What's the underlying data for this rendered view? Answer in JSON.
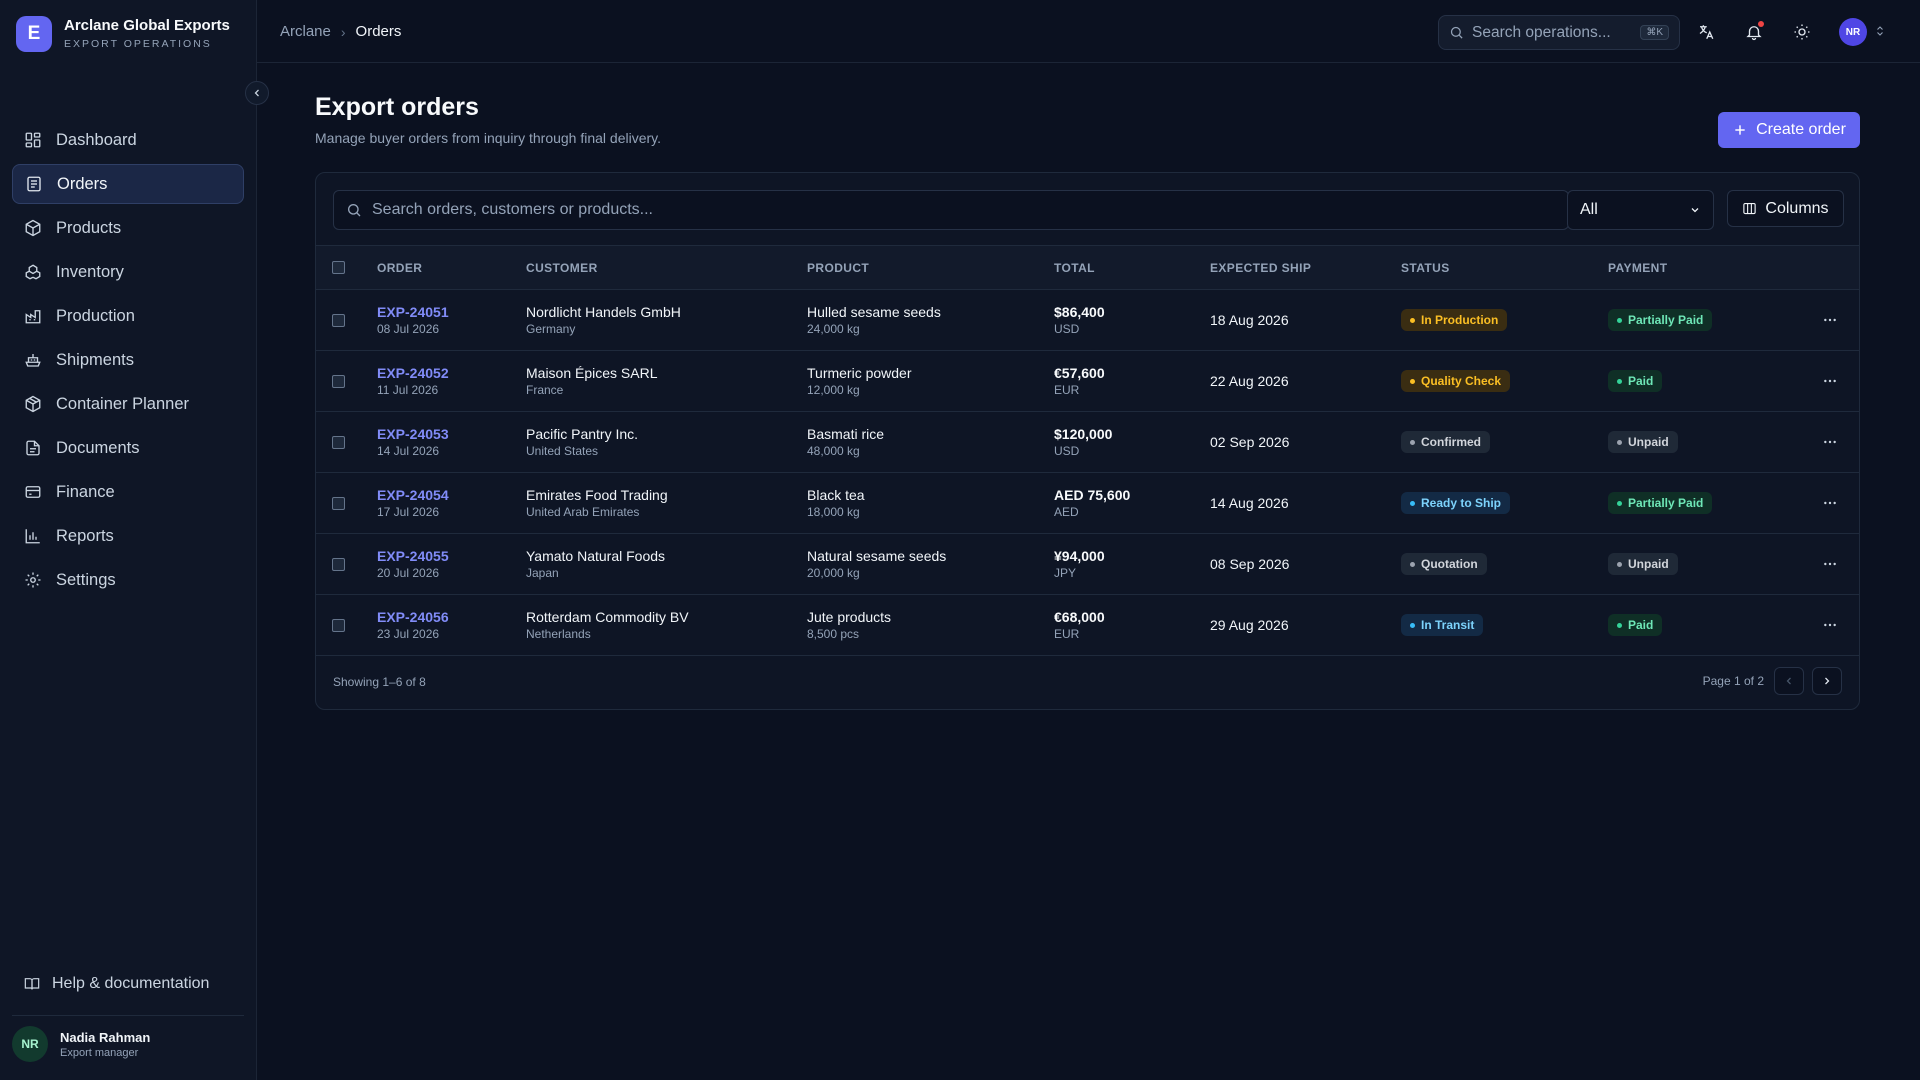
{
  "brand": {
    "logo_letter": "E",
    "name": "Arclane Global Exports",
    "subtitle": "EXPORT OPERATIONS"
  },
  "sidebar": {
    "items": [
      {
        "label": "Dashboard",
        "icon": "dashboard-icon"
      },
      {
        "label": "Orders",
        "icon": "orders-icon",
        "active": true
      },
      {
        "label": "Products",
        "icon": "products-icon"
      },
      {
        "label": "Inventory",
        "icon": "inventory-icon"
      },
      {
        "label": "Production",
        "icon": "production-icon"
      },
      {
        "label": "Shipments",
        "icon": "shipments-icon"
      },
      {
        "label": "Container Planner",
        "icon": "container-icon"
      },
      {
        "label": "Documents",
        "icon": "documents-icon"
      },
      {
        "label": "Finance",
        "icon": "finance-icon"
      },
      {
        "label": "Reports",
        "icon": "reports-icon"
      },
      {
        "label": "Settings",
        "icon": "settings-icon"
      }
    ],
    "help_label": "Help & documentation",
    "user": {
      "initials": "NR",
      "name": "Nadia Rahman",
      "role": "Export manager"
    }
  },
  "topbar": {
    "breadcrumb": [
      "Arclane",
      "Orders"
    ],
    "search_placeholder": "Search operations...",
    "search_shortcut": "⌘K",
    "avatar_initials": "NR"
  },
  "page": {
    "title": "Export orders",
    "subtitle": "Manage buyer orders from inquiry through final delivery.",
    "create_label": "Create order"
  },
  "table": {
    "search_placeholder": "Search orders, customers or products...",
    "filter_value": "All",
    "columns_label": "Columns",
    "headers": {
      "order": "ORDER",
      "customer": "CUSTOMER",
      "product": "PRODUCT",
      "total": "TOTAL",
      "ship": "EXPECTED SHIP",
      "status": "STATUS",
      "payment": "PAYMENT"
    },
    "rows": [
      {
        "id": "EXP-24051",
        "date": "08 Jul 2026",
        "customer": "Nordlicht Handels GmbH",
        "country": "Germany",
        "product": "Hulled sesame seeds",
        "qty": "24,000 kg",
        "total": "$86,400",
        "currency": "USD",
        "ship": "18 Aug 2026",
        "status": "In Production",
        "payment": "Partially Paid"
      },
      {
        "id": "EXP-24052",
        "date": "11 Jul 2026",
        "customer": "Maison Épices SARL",
        "country": "France",
        "product": "Turmeric powder",
        "qty": "12,000 kg",
        "total": "€57,600",
        "currency": "EUR",
        "ship": "22 Aug 2026",
        "status": "Quality Check",
        "payment": "Paid"
      },
      {
        "id": "EXP-24053",
        "date": "14 Jul 2026",
        "customer": "Pacific Pantry Inc.",
        "country": "United States",
        "product": "Basmati rice",
        "qty": "48,000 kg",
        "total": "$120,000",
        "currency": "USD",
        "ship": "02 Sep 2026",
        "status": "Confirmed",
        "payment": "Unpaid"
      },
      {
        "id": "EXP-24054",
        "date": "17 Jul 2026",
        "customer": "Emirates Food Trading",
        "country": "United Arab Emirates",
        "product": "Black tea",
        "qty": "18,000 kg",
        "total": "AED 75,600",
        "currency": "AED",
        "ship": "14 Aug 2026",
        "status": "Ready to Ship",
        "payment": "Partially Paid"
      },
      {
        "id": "EXP-24055",
        "date": "20 Jul 2026",
        "customer": "Yamato Natural Foods",
        "country": "Japan",
        "product": "Natural sesame seeds",
        "qty": "20,000 kg",
        "total": "¥94,000",
        "currency": "JPY",
        "ship": "08 Sep 2026",
        "status": "Quotation",
        "payment": "Unpaid"
      },
      {
        "id": "EXP-24056",
        "date": "23 Jul 2026",
        "customer": "Rotterdam Commodity BV",
        "country": "Netherlands",
        "product": "Jute products",
        "qty": "8,500 pcs",
        "total": "€68,000",
        "currency": "EUR",
        "ship": "29 Aug 2026",
        "status": "In Transit",
        "payment": "Paid"
      }
    ],
    "footer_showing": "Showing 1–6 of 8",
    "footer_page": "Page 1 of 2"
  },
  "colors": {
    "accent": "#6366f1",
    "background": "#0b1120",
    "order_link": "#818cf8"
  }
}
